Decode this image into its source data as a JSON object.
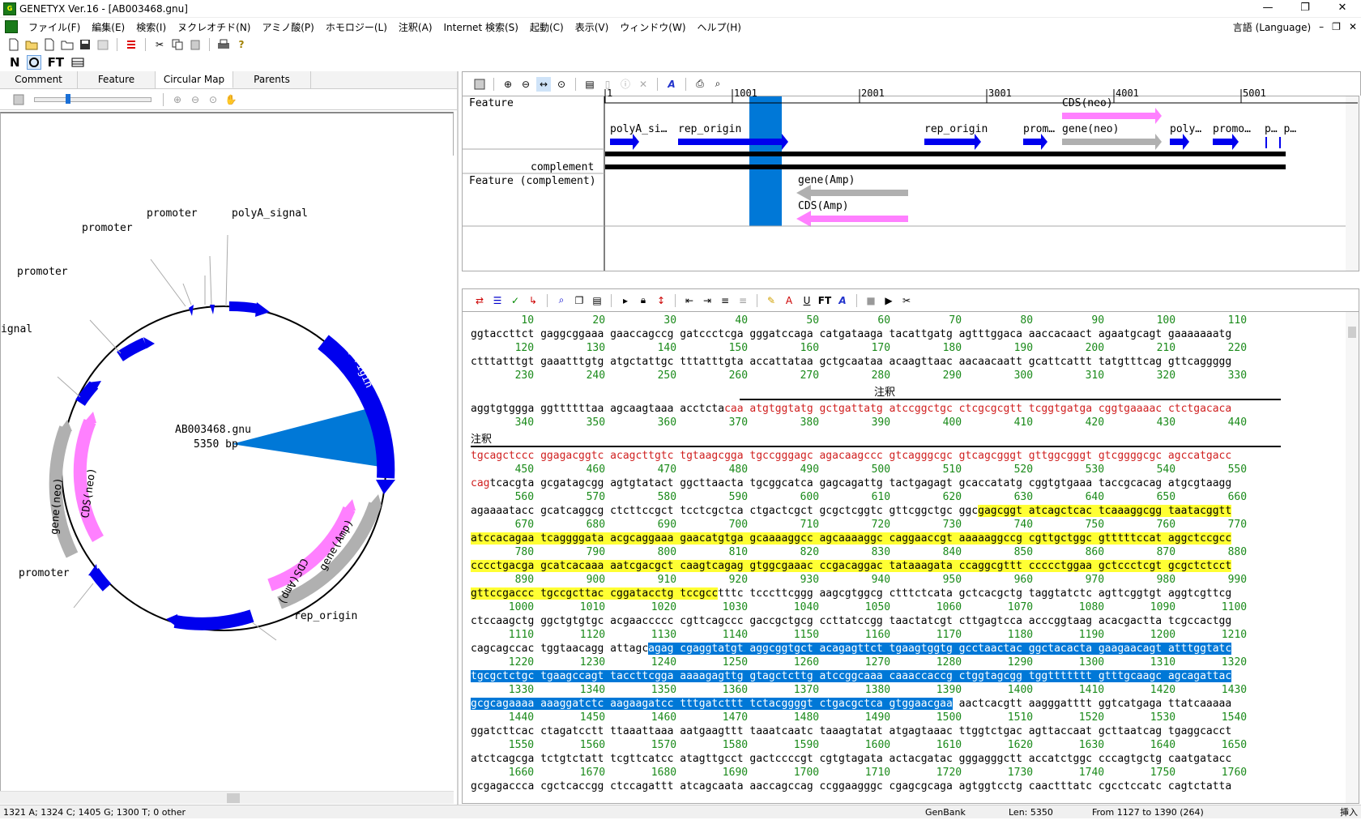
{
  "window": {
    "title": "GENETYX Ver.16 - [AB003468.gnu]",
    "minimize": "—",
    "maximize": "❐",
    "close": "✕"
  },
  "menu": {
    "items": [
      "ファイル(F)",
      "編集(E)",
      "検索(I)",
      "ヌクレオチド(N)",
      "アミノ酸(P)",
      "ホモロジー(L)",
      "注釈(A)",
      "Internet 検索(S)",
      "起動(C)",
      "表示(V)",
      "ウィンドウ(W)",
      "ヘルプ(H)"
    ],
    "language": "言語 (Language)",
    "mdi_min": "–",
    "mdi_restore": "❐",
    "mdi_close": "✕"
  },
  "toolbar2": {
    "n": "N",
    "ft": "FT"
  },
  "left": {
    "tabs": [
      "Comment",
      "Feature",
      "Circular Map",
      "Parents"
    ],
    "active_tab": 2,
    "map": {
      "name": "AB003468.gnu",
      "length": "5350 bp",
      "labels": [
        "promoter",
        "promoter",
        "polyA_signal",
        "promoter",
        "ignal",
        "promoter",
        "rep_origin",
        "rep_origin",
        "gene(neo)",
        "CDS(neo)",
        "CDS(Amp)",
        "gene(Amp)"
      ]
    }
  },
  "feature_map": {
    "ruler": [
      "1",
      "1001",
      "2001",
      "3001",
      "4001",
      "5001"
    ],
    "row_labels": {
      "feature": "Feature",
      "complement": "complement",
      "feature_comp": "Feature (complement)"
    },
    "labels": {
      "polyA": "polyA_si…",
      "rep1": "rep_origin",
      "rep2": "rep_origin",
      "prom1": "prom…",
      "cds_neo": "CDS(neo)",
      "gene_neo": "gene(neo)",
      "poly2": "poly…",
      "promo": "promo…",
      "pp": "p… p…",
      "gene_amp": "gene(Amp)",
      "cds_amp": "CDS(Amp)"
    },
    "colors": {
      "blue": "#0000ee",
      "gray": "#b0b0b0",
      "pink": "#ff80ff",
      "selection": "#0078d7"
    }
  },
  "sequence": {
    "annotation_label": "注釈",
    "numbers": [
      [
        "10",
        "20",
        "30",
        "40",
        "50",
        "60",
        "70",
        "80",
        "90",
        "100",
        "110"
      ],
      [
        "120",
        "130",
        "140",
        "150",
        "160",
        "170",
        "180",
        "190",
        "200",
        "210",
        "220"
      ],
      [
        "230",
        "240",
        "250",
        "260",
        "270",
        "280",
        "290",
        "300",
        "310",
        "320",
        "330"
      ],
      [
        "340",
        "350",
        "360",
        "370",
        "380",
        "390",
        "400",
        "410",
        "420",
        "430",
        "440"
      ],
      [
        "450",
        "460",
        "470",
        "480",
        "490",
        "500",
        "510",
        "520",
        "530",
        "540",
        "550"
      ],
      [
        "560",
        "570",
        "580",
        "590",
        "600",
        "610",
        "620",
        "630",
        "640",
        "650",
        "660"
      ],
      [
        "670",
        "680",
        "690",
        "700",
        "710",
        "720",
        "730",
        "740",
        "750",
        "760",
        "770"
      ],
      [
        "780",
        "790",
        "800",
        "810",
        "820",
        "830",
        "840",
        "850",
        "860",
        "870",
        "880"
      ],
      [
        "890",
        "900",
        "910",
        "920",
        "930",
        "940",
        "950",
        "960",
        "970",
        "980",
        "990"
      ],
      [
        "1000",
        "1010",
        "1020",
        "1030",
        "1040",
        "1050",
        "1060",
        "1070",
        "1080",
        "1090",
        "1100"
      ],
      [
        "1110",
        "1120",
        "1130",
        "1140",
        "1150",
        "1160",
        "1170",
        "1180",
        "1190",
        "1200",
        "1210"
      ],
      [
        "1220",
        "1230",
        "1240",
        "1250",
        "1260",
        "1270",
        "1280",
        "1290",
        "1300",
        "1310",
        "1320"
      ],
      [
        "1330",
        "1340",
        "1350",
        "1360",
        "1370",
        "1380",
        "1390",
        "1400",
        "1410",
        "1420",
        "1430"
      ],
      [
        "1440",
        "1450",
        "1460",
        "1470",
        "1480",
        "1490",
        "1500",
        "1510",
        "1520",
        "1530",
        "1540"
      ],
      [
        "1550",
        "1560",
        "1570",
        "1580",
        "1590",
        "1600",
        "1610",
        "1620",
        "1630",
        "1640",
        "1650"
      ],
      [
        "1660",
        "1670",
        "1680",
        "1690",
        "1700",
        "1710",
        "1720",
        "1730",
        "1740",
        "1750",
        "1760"
      ]
    ],
    "rows": [
      [
        {
          "t": "ggtaccttct gaggcggaaa gaaccagccg gatccctcga gggatccaga catgataaga tacattgatg agtttggaca aaccacaact agaatgcagt gaaaaaaatg",
          "c": ""
        }
      ],
      [
        {
          "t": "ctttatttgt gaaatttgtg atgctattgc tttatttgta accattataa gctgcaataa acaagttaac aacaacaatt gcattcattt tatgtttcag gttcaggggg",
          "c": ""
        }
      ],
      [
        {
          "t": "aggtgtggga ggttttttaa agcaagtaaa acctcta",
          "c": ""
        },
        {
          "t": "caa atgtggtatg gctgattatg atccggctgc ctcgcgcgtt tcggtgatga cggtgaaaac ctctgacaca",
          "c": "r"
        }
      ],
      [
        {
          "t": "tgcagctccc ggagacggtc acagcttgtc tgtaagcgga tgccgggagc agacaagccc gtcagggcgc gtcagcgggt gttggcgggt gtcggggcgc agccatgacc",
          "c": "r"
        }
      ],
      [
        {
          "t": "cag",
          "c": "r"
        },
        {
          "t": "tcacgta gcgatagcgg agtgtatact ggcttaacta tgcggcatca gagcagattg tactgagagt gcaccatatg cggtgtgaaa taccgcacag atgcgtaagg",
          "c": ""
        }
      ],
      [
        {
          "t": "agaaaatacc gcatcaggcg ctcttccgct tcctcgctca ctgactcgct gcgctcggtc gttcggctgc ggc",
          "c": ""
        },
        {
          "t": "gagcggt atcagctcac tcaaaggcgg taatacggtt",
          "c": "y"
        }
      ],
      [
        {
          "t": "atccacagaa tcaggggata acgcaggaaa gaacatgtga gcaaaaggcc agcaaaaggc caggaaccgt aaaaaggccg cgttgctggc gtttttccat aggctccgcc",
          "c": "y"
        }
      ],
      [
        {
          "t": "cccctgacga gcatcacaaa aatcgacgct caagtcagag gtggcgaaac ccgacaggac tataaagata ccaggcgttt ccccctggaa gctccctcgt gcgctctcct",
          "c": "y"
        }
      ],
      [
        {
          "t": "gttccgaccc tgccgcttac cggatacctg tccgcc",
          "c": "y"
        },
        {
          "t": "tttc tcccttcggg aagcgtggcg ctttctcata gctcacgctg taggtatctc agttcggtgt aggtcgttcg",
          "c": ""
        }
      ],
      [
        {
          "t": "ctccaagctg ggctgtgtgc acgaaccccc cgttcagccc gaccgctgcg ccttatccgg taactatcgt cttgagtcca acccggtaag acacgactta tcgccactgg",
          "c": ""
        }
      ],
      [
        {
          "t": "cagcagccac tggtaacagg attagc",
          "c": ""
        },
        {
          "t": "agag cgaggtatgt aggcggtgct acagagttct tgaagtggtg gcctaactac ggctacacta gaagaacagt atttggtatc",
          "c": "b"
        }
      ],
      [
        {
          "t": "tgcgctctgc tgaagccagt taccttcgga aaaagagttg gtagctcttg atccggcaaa caaaccaccg ctggtagcgg tggttttttt gtttgcaagc agcagattac",
          "c": "b"
        }
      ],
      [
        {
          "t": "gcgcagaaaa aaaggatctc aagaagatcc tttgatcttt tctacggggt ctgacgctca gtggaacgaa",
          "c": "b"
        },
        {
          "t": " aactcacgtt aagggatttt ggtcatgaga ttatcaaaaa",
          "c": ""
        }
      ],
      [
        {
          "t": "ggatcttcac ctagatcctt ttaaattaaa aatgaagttt taaatcaatc taaagtatat atgagtaaac ttggtctgac agttaccaat gcttaatcag tgaggcacct",
          "c": ""
        }
      ],
      [
        {
          "t": "atctcagcga tctgtctatt tcgttcatcc atagttgcct gactccccgt cgtgtagata actacgatac gggagggctt accatctggc cccagtgctg caatgatacc",
          "c": ""
        }
      ],
      [
        {
          "t": "gcgagaccca cgctcaccgg ctccagattt atcagcaata aaccagccag ccggaagggc cgagcgcaga agtggtcctg caactttatc cgcctccatc cagtctatta",
          "c": ""
        }
      ]
    ]
  },
  "status": {
    "composition": "1321 A; 1324 C; 1405 G; 1300 T; 0 other",
    "format": "GenBank",
    "length": "Len: 5350",
    "range": "From 1127 to 1390 (264)",
    "mode": "挿入"
  }
}
